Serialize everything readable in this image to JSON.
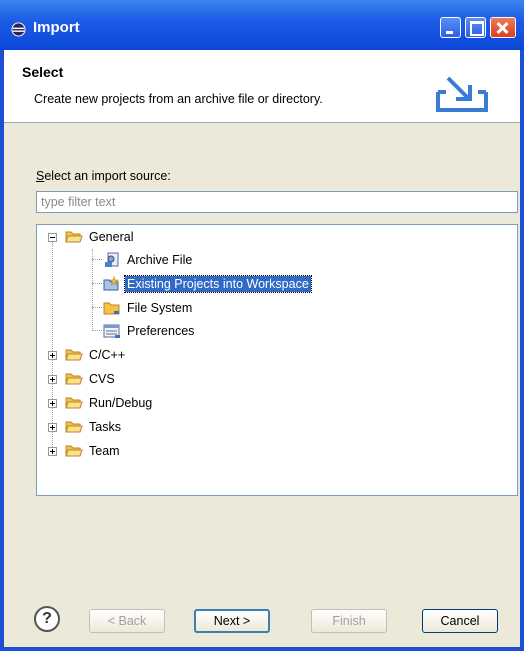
{
  "window": {
    "title": "Import"
  },
  "header": {
    "title": "Select",
    "description": "Create new projects from an archive file or directory."
  },
  "source": {
    "label": "Select an import source:",
    "filter_placeholder": "type filter text",
    "filter_value": ""
  },
  "tree": {
    "general": {
      "label": "General",
      "children": [
        {
          "label": "Archive File",
          "icon": "archive-file-icon"
        },
        {
          "label": "Existing Projects into Workspace",
          "icon": "existing-projects-icon",
          "selected": true
        },
        {
          "label": "File System",
          "icon": "folder-icon"
        },
        {
          "label": "Preferences",
          "icon": "preferences-icon"
        }
      ]
    },
    "collapsed": [
      {
        "label": "C/C++"
      },
      {
        "label": "CVS"
      },
      {
        "label": "Run/Debug"
      },
      {
        "label": "Tasks"
      },
      {
        "label": "Team"
      }
    ]
  },
  "buttons": {
    "help": "?",
    "back": "< Back",
    "next": "Next >",
    "finish": "Finish",
    "cancel": "Cancel"
  },
  "colors": {
    "titlebar": "#0a47d8",
    "selection": "#316ac5",
    "dialog_bg": "#ece9d8",
    "folder": "#f5c242"
  }
}
